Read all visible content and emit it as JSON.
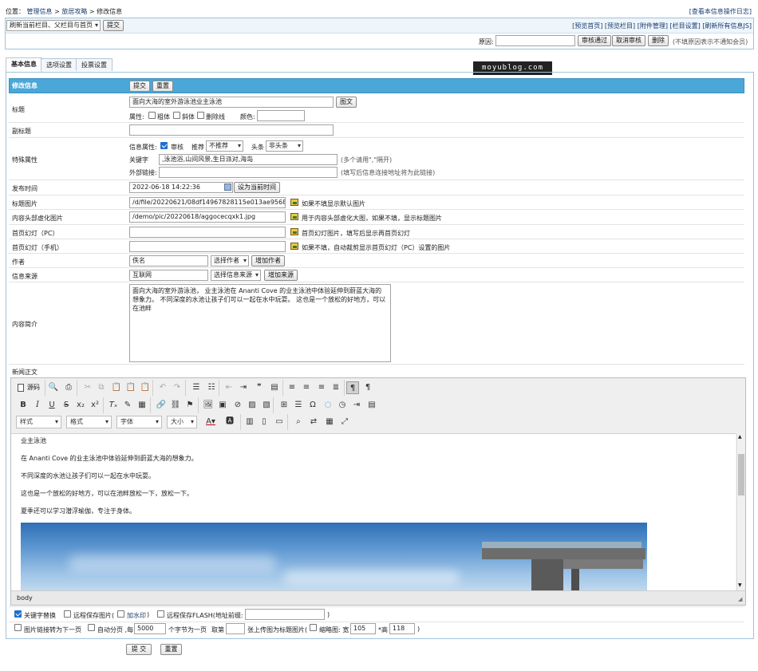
{
  "breadcrumb": {
    "prefix": "位置：",
    "items": [
      "管理信息",
      "旅居攻略",
      "修改信息"
    ],
    "sep": ">",
    "log_link": "[查看本信息操作日志]"
  },
  "toolbar": {
    "refresh_select": "刷新当前栏目、父栏目与首页",
    "submit": "提交",
    "links": [
      "[预览首页]",
      "[预览栏目]",
      "[附件管理]",
      "[栏目设置]",
      "[刷新所有信息JS]"
    ],
    "reason_label": "原因:",
    "approve": "审核通过",
    "cancel_approve": "取消审核",
    "delete": "删除",
    "reason_hint": "(不填原因表示不通知会员)"
  },
  "watermark": "moyublog.com",
  "tabs": [
    "基本信息",
    "选项设置",
    "投票设置"
  ],
  "form": {
    "header": "修改信息",
    "submit": "提交",
    "reset": "重置",
    "title": {
      "label": "标题",
      "value": "面向大海的室外游泳池业主泳池",
      "pic_btn": "图文",
      "attr_label": "属性:",
      "bold": "粗体",
      "italic": "斜体",
      "strike": "删除线",
      "color_label": "颜色:"
    },
    "subtitle": {
      "label": "副标题"
    },
    "special": {
      "label": "特殊属性",
      "info_attr": "信息属性:",
      "review": "审核",
      "recommend_label": "推荐",
      "recommend_value": "不推荐",
      "headline_label": "头条",
      "headline_value": "非头条",
      "keywords_label": "关键字",
      "keywords_value": ",泳池浴,山间风景,生日派对,海岛",
      "keywords_hint": "(多个请用\",\"隔开)",
      "extlink_label": "外部链接:",
      "extlink_hint": "(填写后信息连接地址将为此链接)"
    },
    "pubtime": {
      "label": "发布时间",
      "value": "2022-06-18 14:22:36",
      "btn": "设为当前时间"
    },
    "titlepic": {
      "label": "标题图片",
      "value": "/d/file/20220621/08df14967828115e013ae9568433cab",
      "hint": "如果不填显示默认图片"
    },
    "headpic": {
      "label": "内容头部虚化图片",
      "value": "/demo/pic/20220618/aggocecqxk1.jpg",
      "hint": "用于内容头部虚化大图，如果不填，显示标题图片"
    },
    "slide_pc": {
      "label": "首页幻灯（PC）",
      "hint": "首页幻灯图片，填写后显示再首页幻灯"
    },
    "slide_m": {
      "label": "首页幻灯（手机）",
      "hint": "如果不填，自动裁剪显示首页幻灯（PC）设置的图片"
    },
    "author": {
      "label": "作者",
      "value": "佚名",
      "select": "选择作者",
      "btn": "增加作者"
    },
    "source": {
      "label": "信息来源",
      "value": "互联网",
      "select": "选择信息来源",
      "btn": "增加来源"
    },
    "summary": {
      "label": "内容简介",
      "text": "面向大海的室外游泳池， 业主泳池在 Ananti Cove 的业主泳池中体验延伸到蔚蓝大海的想象力。 不同深度的水池让孩子们可以一起在水中玩耍。 这也是一个放松的好地方，可以在池畔"
    },
    "body_label": "新闻正文"
  },
  "editor": {
    "source_label": "源码",
    "combos": [
      "样式",
      "格式",
      "字体",
      "大小"
    ],
    "paragraphs": [
      "业主泳池",
      "在 Ananti Cove 的业主泳池中体验延伸到蔚蓝大海的想象力。",
      "不同深度的水池让孩子们可以一起在水中玩耍。",
      "这也是一个放松的好地方，可以在池畔放松一下，放松一下。",
      "夏季还可以学习潜浮瑜伽，专注于身体。"
    ],
    "status_path": "body"
  },
  "options": {
    "keyword_replace": "关键字替换",
    "remote_save_pic": "远程保存图片(",
    "add_watermark": "加水印",
    "remote_save_pic_end": ")",
    "remote_flash": "远程保存FLASH(地址前缀:",
    "remote_flash_end": ")",
    "link_next": "图片链接转为下一页",
    "auto_page": "自动分页 ,每",
    "page_chars": "5000",
    "page_chars_unit": "个字节为一页",
    "take_label": "取第",
    "take_suffix": "张上传图为标题图片(",
    "thumb_label": "缩略图: 宽",
    "thumb_w": "105",
    "thumb_h_label": "*高",
    "thumb_h": "118",
    "thumb_end": ")"
  },
  "footer": {
    "submit": "提 交",
    "reset": "重置"
  },
  "colors": {
    "header_bar": "#4aa7d8",
    "accent_link": "#1a3c6e",
    "editor_bg": "#efefef"
  }
}
